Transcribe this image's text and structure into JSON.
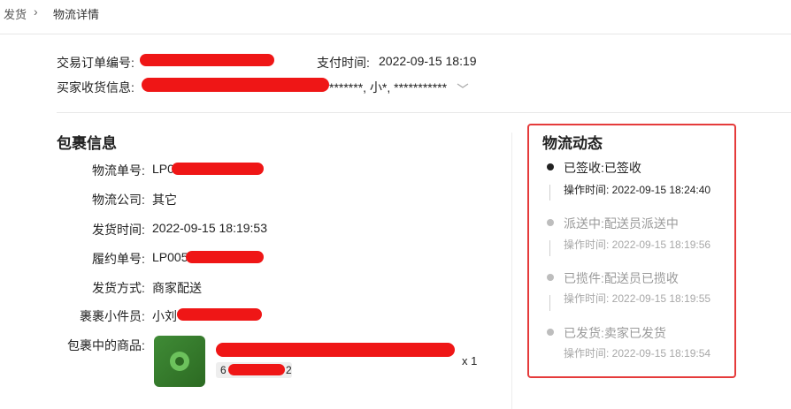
{
  "breadcrumb": {
    "parent": "发货",
    "separator": "›",
    "current": "物流详情"
  },
  "order": {
    "order_no_label": "交易订单编号:",
    "pay_time_label": "支付时间:",
    "pay_time": "2022-09-15 18:19",
    "buyer_label": "买家收货信息:",
    "buyer_tail": "*******, 小*, ***********"
  },
  "package": {
    "title": "包裹信息",
    "rows": [
      {
        "label": "物流单号:",
        "value": "LP0"
      },
      {
        "label": "物流公司:",
        "value": "其它"
      },
      {
        "label": "发货时间:",
        "value": "2022-09-15 18:19:53"
      },
      {
        "label": "履约单号:",
        "value": "LP005"
      },
      {
        "label": "发货方式:",
        "value": "商家配送"
      },
      {
        "label": "裹裹小件员:",
        "value": "小刘"
      }
    ],
    "goods_label": "包裹中的商品:",
    "goods_code_prefix": "6",
    "goods_code_suffix": "2",
    "goods_qty": "x 1"
  },
  "logistics": {
    "title": "物流动态",
    "events": [
      {
        "title": "已签收:已签收",
        "time": "操作时间: 2022-09-15 18:24:40",
        "active": true
      },
      {
        "title": "派送中:配送员派送中",
        "time": "操作时间: 2022-09-15 18:19:56",
        "active": false
      },
      {
        "title": "已揽件:配送员已揽收",
        "time": "操作时间: 2022-09-15 18:19:55",
        "active": false
      },
      {
        "title": "已发货:卖家已发货",
        "time": "操作时间: 2022-09-15 18:19:54",
        "active": false
      }
    ]
  },
  "colors": {
    "highlight_border": "#e53b3b",
    "redaction": "#ef1616"
  }
}
